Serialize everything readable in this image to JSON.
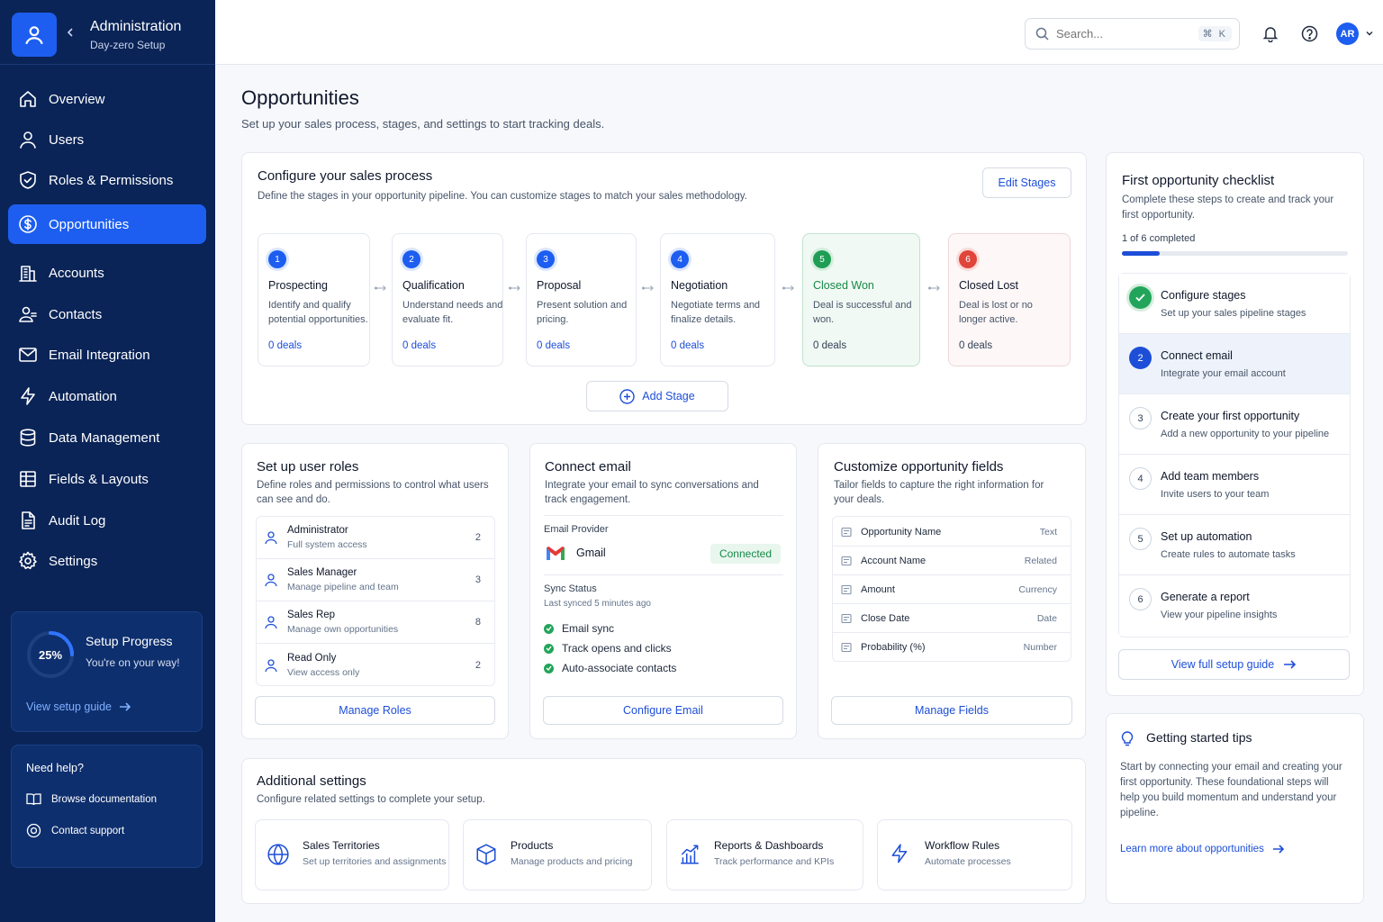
{
  "brand": {
    "title": "Administration",
    "subtitle": "Day-zero Setup"
  },
  "nav": [
    {
      "label": "Overview",
      "icon": "home-icon"
    },
    {
      "label": "Users",
      "icon": "user-icon"
    },
    {
      "label": "Roles & Permissions",
      "icon": "shield-icon"
    },
    {
      "label": "Opportunities",
      "icon": "dollar-icon",
      "active": true
    },
    {
      "label": "Accounts",
      "icon": "building-icon"
    },
    {
      "label": "Contacts",
      "icon": "contacts-icon"
    },
    {
      "label": "Email Integration",
      "icon": "mail-icon"
    },
    {
      "label": "Automation",
      "icon": "bolt-icon"
    },
    {
      "label": "Data Management",
      "icon": "database-icon"
    },
    {
      "label": "Fields & Layouts",
      "icon": "table-icon"
    },
    {
      "label": "Audit Log",
      "icon": "document-icon"
    },
    {
      "label": "Settings",
      "icon": "gear-icon"
    }
  ],
  "setup_progress": {
    "percent_label": "25%",
    "percent": 25,
    "title": "Setup Progress",
    "subtitle": "You're on your way!",
    "link": "View setup guide"
  },
  "help": {
    "title": "Need help?",
    "docs": "Browse documentation",
    "support": "Contact support"
  },
  "topbar": {
    "search_placeholder": "Search...",
    "shortcut": "⌘ K",
    "avatar": "AR"
  },
  "page": {
    "title": "Opportunities",
    "subtitle": "Set up your sales process, stages, and settings to start tracking deals."
  },
  "process": {
    "title": "Configure your sales process",
    "subtitle": "Define the stages in your opportunity pipeline. You can customize stages to match your sales methodology.",
    "edit_button": "Edit Stages",
    "add_button": "Add Stage",
    "stages": [
      {
        "num": "1",
        "title": "Prospecting",
        "desc": "Identify and qualify potential opportunities.",
        "count": "0 deals",
        "color": "#1d5ef0"
      },
      {
        "num": "2",
        "title": "Qualification",
        "desc": "Understand needs and evaluate fit.",
        "count": "0 deals",
        "color": "#1d5ef0"
      },
      {
        "num": "3",
        "title": "Proposal",
        "desc": "Present solution and pricing.",
        "count": "0 deals",
        "color": "#1d5ef0"
      },
      {
        "num": "4",
        "title": "Negotiation",
        "desc": "Negotiate terms and finalize details.",
        "count": "0 deals",
        "color": "#1d5ef0"
      },
      {
        "num": "5",
        "title": "Closed Won",
        "desc": "Deal is successful and won.",
        "count": "0 deals",
        "color": "#1f9d55"
      },
      {
        "num": "6",
        "title": "Closed Lost",
        "desc": "Deal is lost or no longer active.",
        "count": "0 deals",
        "color": "#e0453a"
      }
    ]
  },
  "roles": {
    "title": "Set up user roles",
    "subtitle": "Define roles and permissions to control what users can see and do.",
    "items": [
      {
        "name": "Administrator",
        "desc": "Full system access",
        "count": "2"
      },
      {
        "name": "Sales Manager",
        "desc": "Manage pipeline and team",
        "count": "3"
      },
      {
        "name": "Sales Rep",
        "desc": "Manage own opportunities",
        "count": "8"
      },
      {
        "name": "Read Only",
        "desc": "View access only",
        "count": "2"
      }
    ],
    "button": "Manage Roles"
  },
  "email": {
    "title": "Connect email",
    "subtitle": "Integrate your email to sync conversations and track engagement.",
    "provider_label": "Email Provider",
    "provider": "Gmail",
    "status": "Connected",
    "sync_label": "Sync Status",
    "last_synced": "Last synced 5 minutes ago",
    "features": [
      "Email sync",
      "Track opens and clicks",
      "Auto-associate contacts"
    ],
    "button": "Configure Email"
  },
  "fields": {
    "title": "Customize opportunity fields",
    "subtitle": "Tailor fields to capture the right information for your deals.",
    "items": [
      {
        "name": "Opportunity Name",
        "type": "Text"
      },
      {
        "name": "Account Name",
        "type": "Related"
      },
      {
        "name": "Amount",
        "type": "Currency"
      },
      {
        "name": "Close Date",
        "type": "Date"
      },
      {
        "name": "Probability (%)",
        "type": "Number"
      }
    ],
    "button": "Manage Fields"
  },
  "additional": {
    "title": "Additional settings",
    "subtitle": "Configure related settings to complete your setup.",
    "tiles": [
      {
        "title": "Sales Territories",
        "desc": "Set up territories and assignments",
        "icon": "globe-icon"
      },
      {
        "title": "Products",
        "desc": "Manage products and pricing",
        "icon": "box-icon"
      },
      {
        "title": "Reports & Dashboards",
        "desc": "Track performance and KPIs",
        "icon": "chart-icon"
      },
      {
        "title": "Workflow Rules",
        "desc": "Automate processes",
        "icon": "bolt-icon"
      }
    ]
  },
  "checklist": {
    "title": "First opportunity checklist",
    "subtitle": "Complete these steps to create and track your first opportunity.",
    "progress_label": "1 of 6 completed",
    "progress": 0.1667,
    "items": [
      {
        "num": "✓",
        "title": "Configure stages",
        "desc": "Set up your sales pipeline stages",
        "state": "done"
      },
      {
        "num": "2",
        "title": "Connect email",
        "desc": "Integrate your email account",
        "state": "current"
      },
      {
        "num": "3",
        "title": "Create your first opportunity",
        "desc": "Add a new opportunity to your pipeline",
        "state": "todo"
      },
      {
        "num": "4",
        "title": "Add team members",
        "desc": "Invite users to your team",
        "state": "todo"
      },
      {
        "num": "5",
        "title": "Set up automation",
        "desc": "Create rules to automate tasks",
        "state": "todo"
      },
      {
        "num": "6",
        "title": "Generate a report",
        "desc": "View your pipeline insights",
        "state": "todo"
      }
    ],
    "guide_button": "View full setup guide"
  },
  "tips": {
    "title": "Getting started tips",
    "body": "Start by connecting your email and creating your first opportunity. These foundational steps will help you build momentum and understand your pipeline.",
    "link": "Learn more about opportunities"
  }
}
